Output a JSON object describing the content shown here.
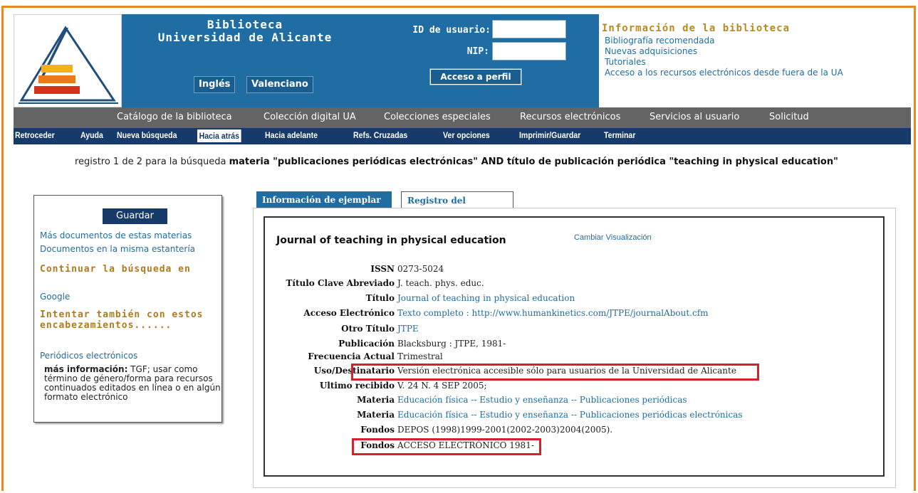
{
  "header": {
    "library_title_line1": "Biblioteca",
    "library_title_line2": "Universidad de Alicante",
    "lang_english": "Inglés",
    "lang_valencian": "Valenciano",
    "user_id_label": "ID de usuario:",
    "pin_label": "NIP:",
    "user_id_value": "",
    "pin_value": "",
    "profile_button": "Acceso a perfil"
  },
  "info": {
    "title": "Información de la biblioteca",
    "links": [
      "Bibliografía recomendada",
      "Nuevas adquisiciones",
      "Tutoriales",
      "Acceso a los recursos electrónicos desde fuera de la UA"
    ]
  },
  "nav_main": [
    "Catálogo de la biblioteca",
    "Colección digital UA",
    "Colecciones especiales",
    "Recursos electrónicos",
    "Servicios al usuario",
    "Solicitud"
  ],
  "nav_sub": [
    "Retroceder",
    "Ayuda",
    "Nueva búsqueda",
    "Hacia atrás",
    "Hacia adelante",
    "Refs. Cruzadas",
    "Ver opciones",
    "Imprimir/Guardar",
    "Terminar"
  ],
  "search": {
    "prefix": "registro 1 de 2 para la búsqueda",
    "query": "materia \"publicaciones periódicas electrónicas\" AND título de publicación periódica \"teaching in physical education\""
  },
  "left_panel": {
    "save_button": "Guardar",
    "link_more_docs": "Más documentos de estas materias",
    "link_same_shelf": "Documentos en la misma estantería",
    "continue_heading": "Continuar la búsqueda en",
    "google_link": "Google",
    "try_heading": "Intentar también con estos encabezamientos......",
    "periodicos_link": "Periódicos electrónicos",
    "more_info_label": "más información:",
    "more_info_text": "TGF; usar como término de género/forma para recursos continuados editados en línea o en algún formato electrónico"
  },
  "tabs": {
    "active": "Información de ejemplar",
    "inactive": "Registro del catálogo"
  },
  "record": {
    "title": "Journal of teaching in physical education",
    "change_view": "Cambiar Visualización",
    "fields": [
      {
        "label": "ISSN",
        "value": "0273-5024"
      },
      {
        "label": "Título Clave Abreviado",
        "value": "J. teach. phys. educ."
      },
      {
        "label": "Título",
        "value": "Journal of teaching in physical education"
      },
      {
        "label": "Acceso Electrónico",
        "value": "Texto completo : http://www.humankinetics.com/JTPE/journalAbout.cfm"
      },
      {
        "label": "Otro Título",
        "value": "JTPE"
      },
      {
        "label": "Publicación",
        "value": "Blacksburg : JTPE, 1981-"
      },
      {
        "label": "Frecuencia Actual",
        "value": "Trimestral"
      },
      {
        "label": "Uso/Destinatario",
        "value": "Versión electrónica accesible sólo para usuarios de la Universidad de Alicante"
      },
      {
        "label": "Ultimo recibido",
        "value": "V. 24 N. 4 SEP 2005;"
      },
      {
        "label": "Materia",
        "value": "Educación física -- Estudio y enseñanza -- Publicaciones periódicas"
      },
      {
        "label": "Materia",
        "value": "Educación física -- Estudio y enseñanza -- Publicaciones periódicas electrónicas"
      },
      {
        "label": "Fondos",
        "value": "DEPOS (1998)1999-2001(2002-2003)2004(2005)."
      },
      {
        "label": "Fondos",
        "value": "ACCESO ELECTRÓNICO 1981-"
      }
    ]
  },
  "colors": {
    "frame": "#e88a1f",
    "header_blue": "#1f6da3",
    "nav_gray": "#646464",
    "nav_dark": "#163b6a",
    "gold": "#b07a1a",
    "highlight": "#d62030"
  }
}
